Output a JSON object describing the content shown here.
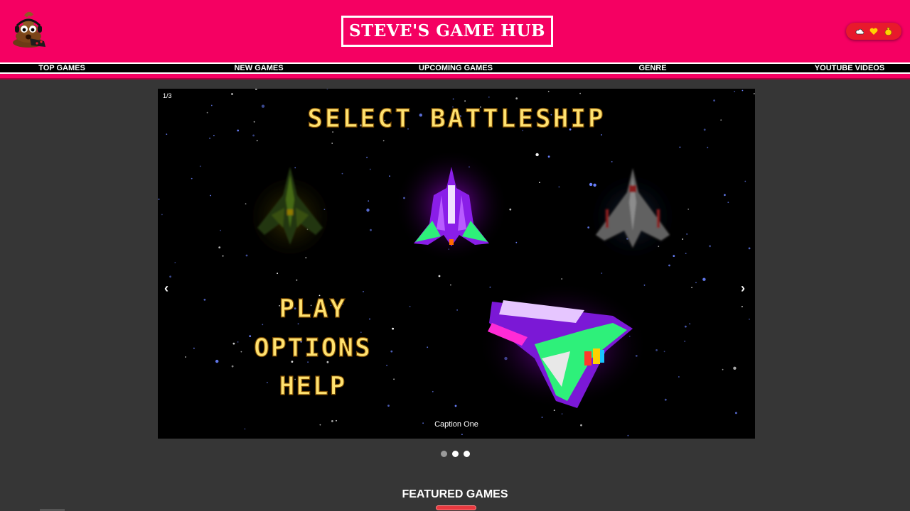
{
  "header": {
    "title": "STEVE'S GAME HUB",
    "logo_icon": "poop-gamer-logo-icon",
    "status_icons": [
      "cloud-icon",
      "heart-icon",
      "money-bag-icon"
    ]
  },
  "nav": {
    "items": [
      {
        "label": "TOP GAMES"
      },
      {
        "label": "NEW GAMES"
      },
      {
        "label": "UPCOMING GAMES"
      },
      {
        "label": "GENRE"
      },
      {
        "label": "YOUTUBE VIDEOS"
      }
    ]
  },
  "carousel": {
    "counter": "1/3",
    "prev_label": "‹",
    "next_label": "›",
    "caption": "Caption One",
    "slide": {
      "heading": "SELECT BATTLESHIP",
      "menu": [
        "PLAY",
        "OPTIONS",
        "HELP"
      ]
    },
    "dots": 3,
    "active_dot": 0
  },
  "featured": {
    "title": "FEATURED GAMES"
  },
  "colors": {
    "brand_pink": "#f50062",
    "background": "#363636",
    "accent_red": "#e8393f",
    "pixel_text_yellow": "#ffe270"
  }
}
